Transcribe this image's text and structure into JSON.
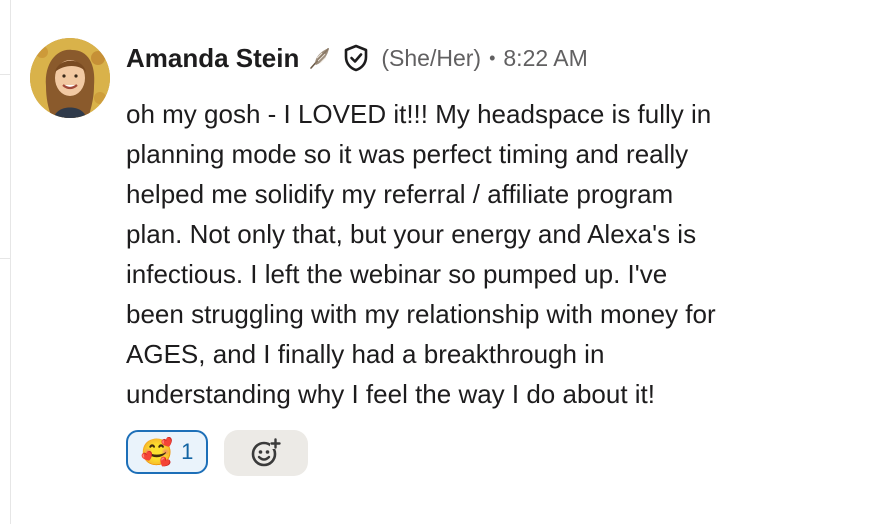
{
  "message": {
    "author": "Amanda Stein",
    "pronouns": "(She/Her)",
    "separator": "•",
    "time": "8:22 AM",
    "lines": [
      "oh my gosh - I LOVED it!!! My headspace is fully in",
      "planning mode so it was perfect timing and really",
      "helped me solidify my referral / affiliate program",
      "plan. Not only that, but your energy and Alexa's is",
      "infectious. I left the webinar so pumped up. I've",
      "been struggling with my relationship with money for",
      "AGES, and I finally had a breakthrough in",
      "understanding why I feel the way I do about it!"
    ],
    "icons": {
      "status": "feather-icon",
      "verified": "shield-check-icon",
      "add_reaction": "add-reaction-icon"
    }
  },
  "reactions": [
    {
      "emoji": "🥰",
      "count": "1"
    }
  ],
  "colors": {
    "text": "#1d1c1d",
    "muted": "#616061",
    "reaction_border": "#1d6fb8",
    "reaction_bg": "#eaf3fb",
    "add_bg": "#eceae6"
  }
}
